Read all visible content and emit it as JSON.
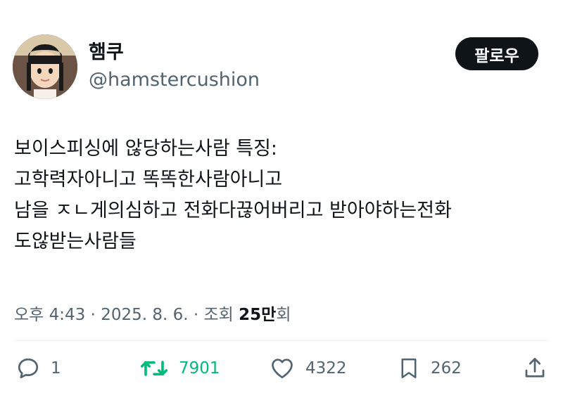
{
  "tweet": {
    "author": {
      "display_name": "햄쿠",
      "handle": "@hamstercushion",
      "avatar_icon": "avatar-mii-character"
    },
    "follow_label": "팔로우",
    "body_lines": [
      "보이스피싱에 않당하는사람 특징:",
      "고학력자아니고 똑똑한사람아니고",
      "남을 ㅈㄴ게의심하고 전화다끊어버리고 받아야하는전화",
      "도않받는사람들"
    ],
    "meta": {
      "time": "오후 4:43",
      "separator": " · ",
      "date": "2025. 8. 6.",
      "views_label": "조회",
      "views_count": "25만",
      "views_suffix": "회"
    },
    "actions": {
      "reply_count": "1",
      "retweet_count": "7901",
      "like_count": "4322",
      "bookmark_count": "262"
    },
    "colors": {
      "text": "#0f1419",
      "secondary": "#536471",
      "retweet": "#00ba7c",
      "button_bg": "#0f1419"
    }
  }
}
